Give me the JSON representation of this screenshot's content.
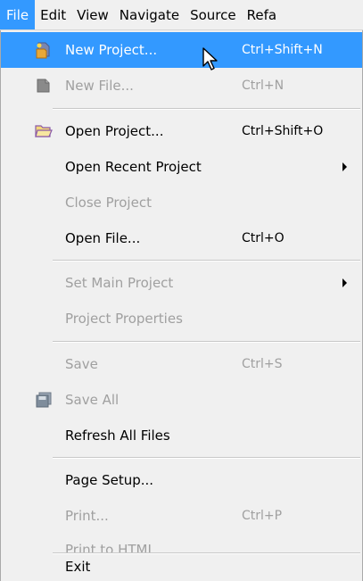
{
  "menubar": {
    "items": [
      "File",
      "Edit",
      "View",
      "Navigate",
      "Source",
      "Refa"
    ]
  },
  "file_menu": {
    "new_project": {
      "label": "New Project...",
      "shortcut": "Ctrl+Shift+N"
    },
    "new_file": {
      "label": "New File...",
      "shortcut": "Ctrl+N"
    },
    "open_project": {
      "label": "Open Project...",
      "shortcut": "Ctrl+Shift+O"
    },
    "open_recent_project": {
      "label": "Open Recent Project"
    },
    "close_project": {
      "label": "Close Project"
    },
    "open_file": {
      "label": "Open File...",
      "shortcut": "Ctrl+O"
    },
    "set_main_project": {
      "label": "Set Main Project"
    },
    "project_properties": {
      "label": "Project Properties"
    },
    "save": {
      "label": "Save",
      "shortcut": "Ctrl+S"
    },
    "save_all": {
      "label": "Save All"
    },
    "refresh_all_files": {
      "label": "Refresh All Files"
    },
    "page_setup": {
      "label": "Page Setup..."
    },
    "print": {
      "label": "Print...",
      "shortcut": "Ctrl+P"
    },
    "print_to_html": {
      "label": "Print to HTML..."
    },
    "exit": {
      "label": "Exit"
    }
  },
  "colors": {
    "highlight": "#3399ff",
    "disabled_text": "#a0a0a0",
    "background": "#f0f0f0"
  },
  "icons": {
    "new_project": "new-project-icon",
    "new_file": "new-file-icon",
    "open_project": "open-folder-icon",
    "save_all": "save-all-icon"
  }
}
